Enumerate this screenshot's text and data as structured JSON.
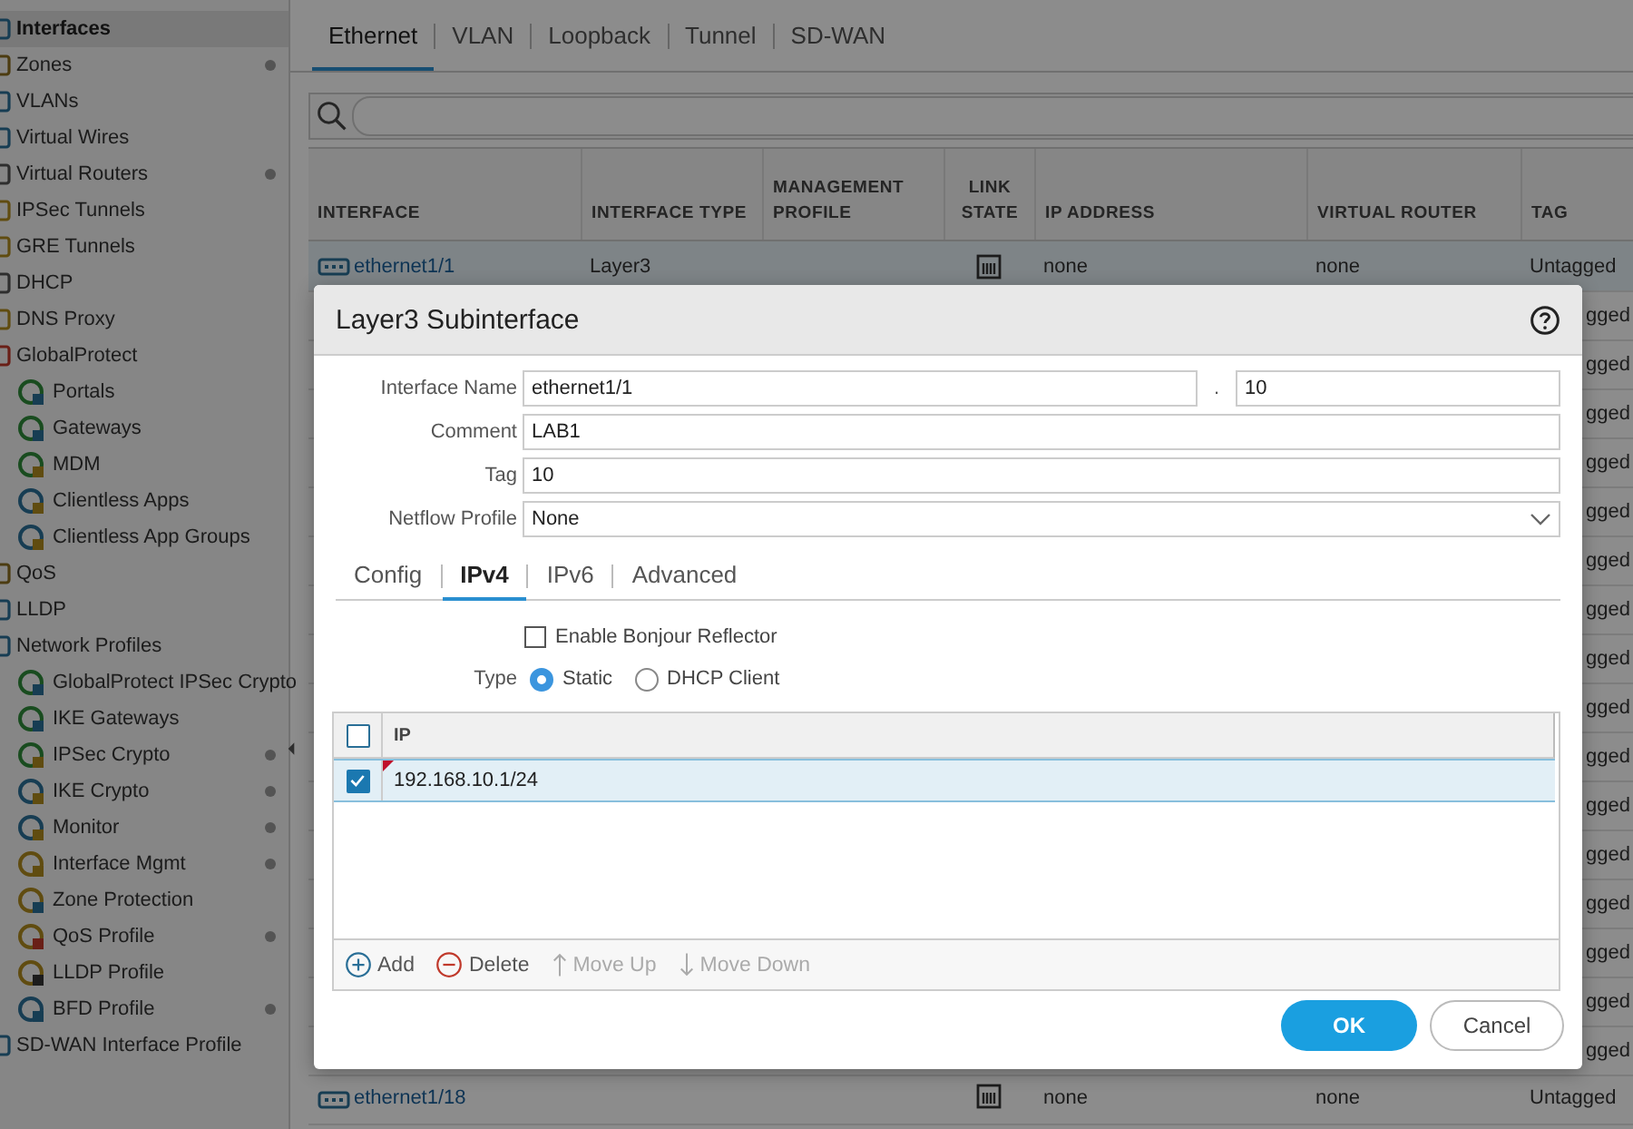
{
  "sidebar": {
    "items": [
      {
        "label": "Interfaces",
        "selected": true,
        "dot": false
      },
      {
        "label": "Zones",
        "selected": false,
        "dot": true
      },
      {
        "label": "VLANs",
        "selected": false,
        "dot": false
      },
      {
        "label": "Virtual Wires",
        "selected": false,
        "dot": false
      },
      {
        "label": "Virtual Routers",
        "selected": false,
        "dot": true
      },
      {
        "label": "IPSec Tunnels",
        "selected": false,
        "dot": false
      },
      {
        "label": "GRE Tunnels",
        "selected": false,
        "dot": false
      },
      {
        "label": "DHCP",
        "selected": false,
        "dot": false
      },
      {
        "label": "DNS Proxy",
        "selected": false,
        "dot": false
      },
      {
        "label": "GlobalProtect",
        "selected": false,
        "dot": false,
        "children": [
          {
            "label": "Portals",
            "selected": false,
            "dot": false
          },
          {
            "label": "Gateways",
            "selected": false,
            "dot": false
          },
          {
            "label": "MDM",
            "selected": false,
            "dot": false
          },
          {
            "label": "Clientless Apps",
            "selected": false,
            "dot": false
          },
          {
            "label": "Clientless App Groups",
            "selected": false,
            "dot": false
          }
        ]
      },
      {
        "label": "QoS",
        "selected": false,
        "dot": false
      },
      {
        "label": "LLDP",
        "selected": false,
        "dot": false
      },
      {
        "label": "Network Profiles",
        "selected": false,
        "dot": false,
        "children": [
          {
            "label": "GlobalProtect IPSec Crypto",
            "selected": false,
            "dot": false
          },
          {
            "label": "IKE Gateways",
            "selected": false,
            "dot": false
          },
          {
            "label": "IPSec Crypto",
            "selected": false,
            "dot": true
          },
          {
            "label": "IKE Crypto",
            "selected": false,
            "dot": true
          },
          {
            "label": "Monitor",
            "selected": false,
            "dot": true
          },
          {
            "label": "Interface Mgmt",
            "selected": false,
            "dot": true
          },
          {
            "label": "Zone Protection",
            "selected": false,
            "dot": false
          },
          {
            "label": "QoS Profile",
            "selected": false,
            "dot": true
          },
          {
            "label": "LLDP Profile",
            "selected": false,
            "dot": false
          },
          {
            "label": "BFD Profile",
            "selected": false,
            "dot": true
          }
        ]
      },
      {
        "label": "SD-WAN Interface Profile",
        "selected": false,
        "dot": false
      }
    ]
  },
  "tabs": [
    {
      "label": "Ethernet",
      "selected": true
    },
    {
      "label": "VLAN",
      "selected": false
    },
    {
      "label": "Loopback",
      "selected": false
    },
    {
      "label": "Tunnel",
      "selected": false
    },
    {
      "label": "SD-WAN",
      "selected": false
    }
  ],
  "table": {
    "columns": [
      "INTERFACE",
      "INTERFACE TYPE",
      "MANAGEMENT PROFILE",
      "LINK STATE",
      "IP ADDRESS",
      "VIRTUAL ROUTER",
      "TAG"
    ],
    "rows": [
      {
        "interface": "ethernet1/1",
        "interface_type": "Layer3",
        "ip_address": "none",
        "virtual_router": "none",
        "tag": "Untagged"
      },
      {
        "tag": "gged"
      },
      {
        "tag": "gged"
      },
      {
        "tag": "gged"
      },
      {
        "tag": "gged"
      },
      {
        "tag": "gged"
      },
      {
        "tag": "gged"
      },
      {
        "tag": "gged"
      },
      {
        "tag": "gged"
      },
      {
        "tag": "gged"
      },
      {
        "tag": "gged"
      },
      {
        "tag": "gged"
      },
      {
        "tag": "gged"
      },
      {
        "tag": "gged"
      },
      {
        "tag": "gged"
      },
      {
        "tag": "gged"
      },
      {
        "tag": "gged"
      },
      {
        "interface": "ethernet1/18",
        "ip_address": "none",
        "virtual_router": "none",
        "tag": "Untagged"
      }
    ]
  },
  "dialog": {
    "title": "Layer3 Subinterface",
    "fields": [
      {
        "kind": "split",
        "label": "Interface Name",
        "value": "ethernet1/1",
        "separator": ".",
        "suffix": "10"
      },
      {
        "kind": "text",
        "label": "Comment",
        "value": "LAB1"
      },
      {
        "kind": "text",
        "label": "Tag",
        "value": "10"
      },
      {
        "kind": "select",
        "label": "Netflow Profile",
        "value": "None"
      }
    ],
    "tabs": [
      {
        "label": "Config",
        "selected": false
      },
      {
        "label": "IPv4",
        "selected": true
      },
      {
        "label": "IPv6",
        "selected": false
      },
      {
        "label": "Advanced",
        "selected": false
      }
    ],
    "bonjour": {
      "label": "Enable Bonjour Reflector",
      "checked": false
    },
    "type": {
      "label": "Type",
      "options": [
        {
          "label": "Static",
          "selected": true
        },
        {
          "label": "DHCP Client",
          "selected": false
        }
      ]
    },
    "ip_table": {
      "column": "IP",
      "all_checked": false,
      "rows": [
        {
          "ip": "192.168.10.1/24",
          "checked": true,
          "selected": true
        }
      ]
    },
    "actions": [
      {
        "kind": "add",
        "label": "Add",
        "disabled": false
      },
      {
        "kind": "delete",
        "label": "Delete",
        "disabled": false
      },
      {
        "kind": "up",
        "label": "Move Up",
        "disabled": true
      },
      {
        "kind": "down",
        "label": "Move Down",
        "disabled": true
      }
    ],
    "buttons": [
      {
        "kind": "primary",
        "label": "OK"
      },
      {
        "kind": "secondary",
        "label": "Cancel"
      }
    ]
  }
}
